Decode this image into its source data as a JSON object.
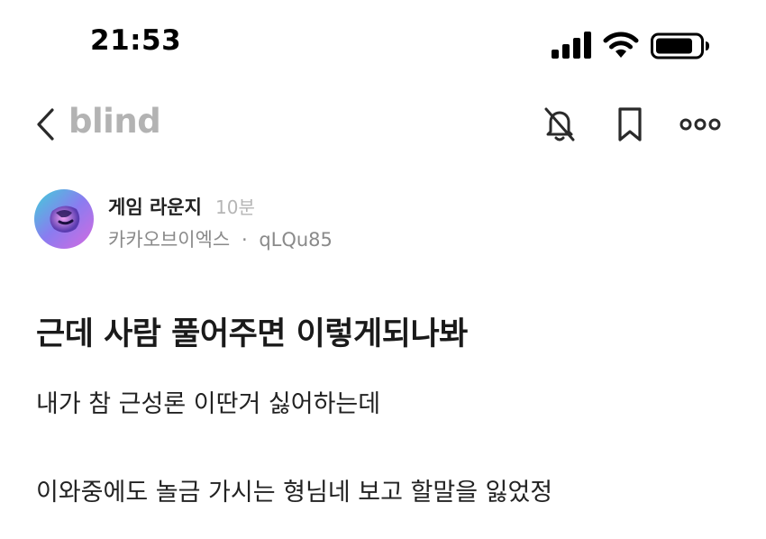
{
  "status_bar": {
    "time": "21:53",
    "icons": [
      "signal-icon",
      "wifi-icon",
      "battery-icon"
    ]
  },
  "nav": {
    "logo": "blind",
    "back_icon": "chevron-left-icon",
    "actions": [
      "bell-off-icon",
      "bookmark-icon",
      "more-horizontal-icon"
    ]
  },
  "author": {
    "channel": "게임 라운지",
    "time_ago": "10분",
    "company": "카카오브이엑스",
    "separator": "·",
    "nickname": "qLQu85"
  },
  "post": {
    "title": "근데 사람 풀어주면 이렇게되나봐",
    "body_lines": [
      "내가 참 근성론 이딴거 싫어하는데",
      "이와중에도 놀금 가시는 형님네 보고 할말을 잃었정"
    ]
  },
  "colors": {
    "logo": "#b3b3b3",
    "muted_text": "#8a8a8a",
    "time_text": "#b5b5b5",
    "text": "#1a1a1a"
  }
}
